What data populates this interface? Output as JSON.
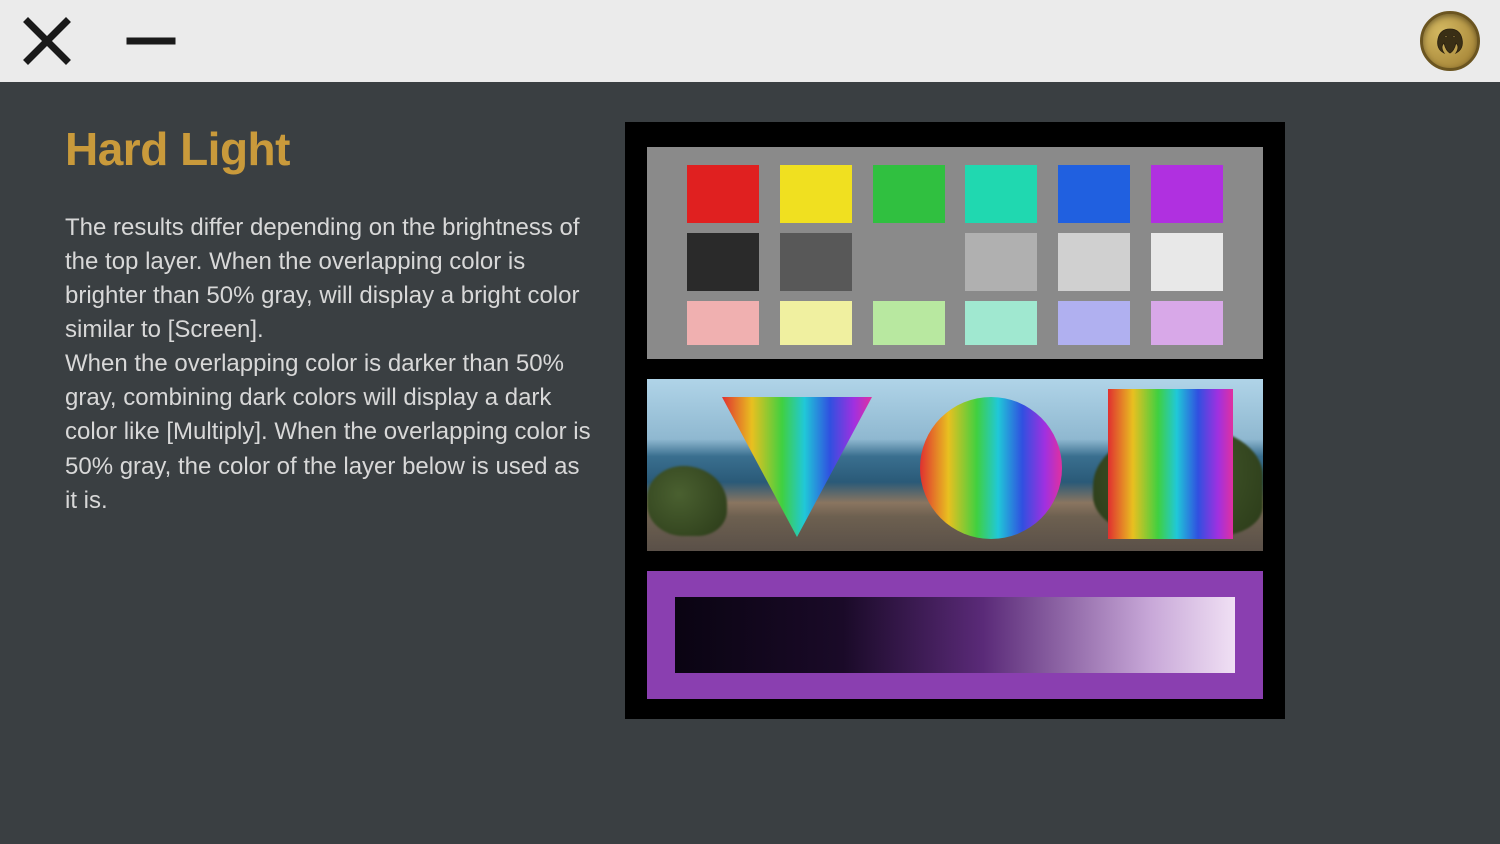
{
  "titlebar": {
    "close_label": "Close",
    "minimize_label": "Minimize"
  },
  "page": {
    "title": "Hard Light",
    "body": "The results differ depending on the brightness of the top layer. When the overlapping color is brighter than 50% gray, will display a bright color similar to [Screen].\nWhen the overlapping color is darker than 50% gray, combining dark colors will display a dark color like [Multiply]. When the overlapping color is 50% gray, the color of the layer below is used as it is."
  },
  "swatches": {
    "row1": [
      "#e02020",
      "#f0e020",
      "#30c040",
      "#20d8b0",
      "#2060e0",
      "#b030e0"
    ],
    "row2": [
      "#2a2a2a",
      "#585858",
      "#8a8a8a",
      "#b0b0b0",
      "#d0d0d0",
      "#e8e8e8"
    ],
    "row3": [
      "#f0b0b0",
      "#f0f0a0",
      "#b8e8a0",
      "#a0e8d0",
      "#b0b0f0",
      "#d8a8e8"
    ]
  },
  "gradient_panel": {
    "bg": "#8a3fb0"
  }
}
